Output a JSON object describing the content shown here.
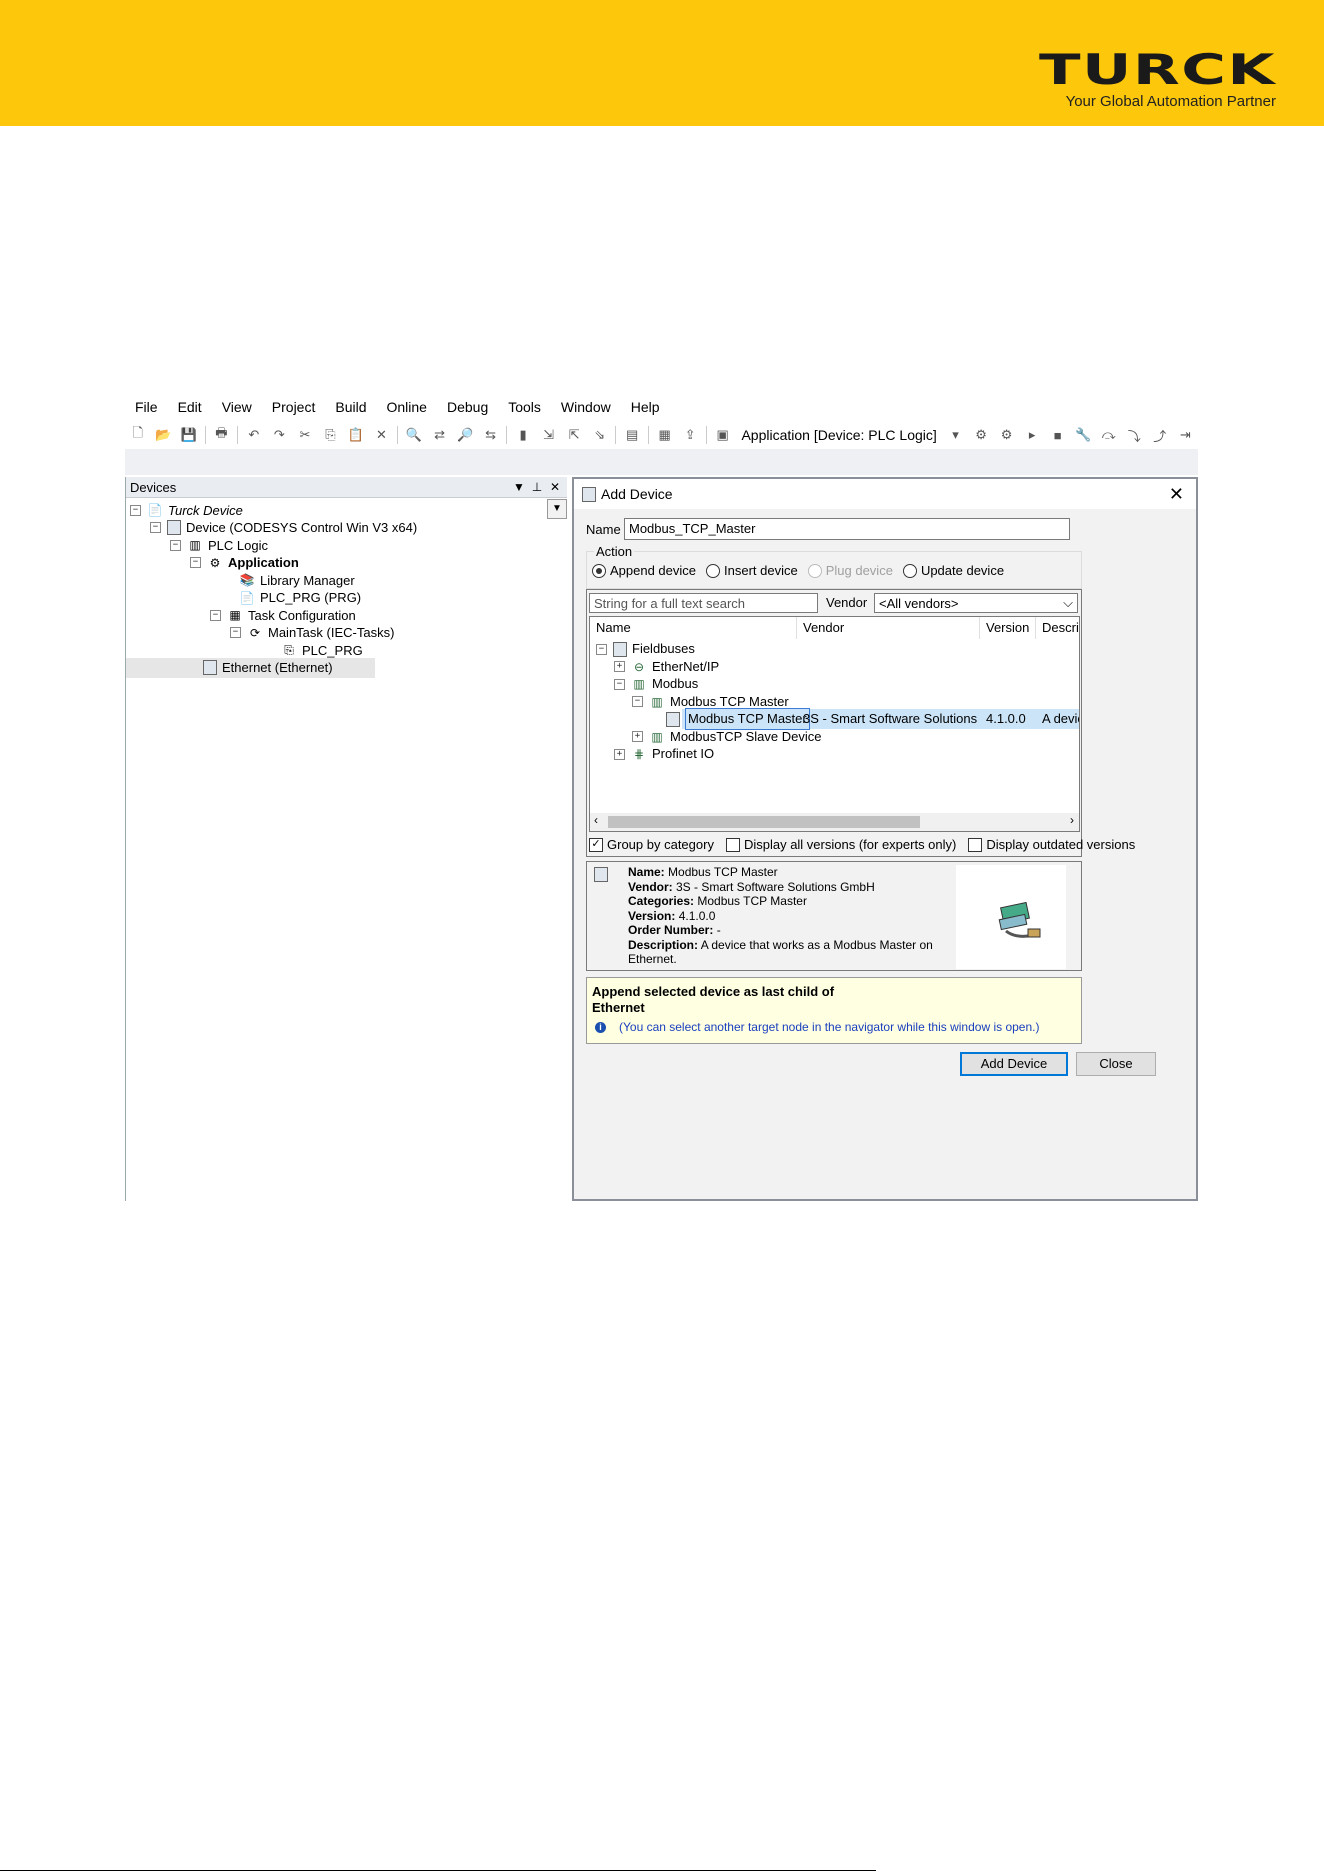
{
  "banner": {
    "color": "#fdc70b",
    "logo_word": "TURCK",
    "logo_tagline": "Your Global Automation Partner"
  },
  "menubar": {
    "items": [
      "File",
      "Edit",
      "View",
      "Project",
      "Build",
      "Online",
      "Debug",
      "Tools",
      "Window",
      "Help"
    ]
  },
  "toolbar": {
    "application_combo": "Application [Device: PLC Logic]"
  },
  "devices_panel": {
    "title": "Devices",
    "tree": [
      {
        "label": "Turck Device",
        "italic": true
      },
      {
        "label": "Device (CODESYS Control Win V3 x64)"
      },
      {
        "label": "PLC Logic"
      },
      {
        "label": "Application",
        "bold": true
      },
      {
        "label": "Library Manager"
      },
      {
        "label": "PLC_PRG (PRG)"
      },
      {
        "label": "Task Configuration"
      },
      {
        "label": "MainTask (IEC-Tasks)"
      },
      {
        "label": "PLC_PRG"
      },
      {
        "label": "Ethernet (Ethernet)",
        "selected": true
      }
    ]
  },
  "dialog": {
    "title": "Add Device",
    "name_label": "Name",
    "name_value": "Modbus_TCP_Master",
    "action_label": "Action",
    "actions": [
      {
        "label": "Append device",
        "selected": true,
        "enabled": true
      },
      {
        "label": "Insert device",
        "selected": false,
        "enabled": true
      },
      {
        "label": "Plug device",
        "selected": false,
        "enabled": false
      },
      {
        "label": "Update device",
        "selected": false,
        "enabled": true
      }
    ],
    "search_placeholder": "String for a full text search",
    "vendor_label": "Vendor",
    "vendor_value": "<All vendors>",
    "columns": [
      "Name",
      "Vendor",
      "Version",
      "Descrip"
    ],
    "rows": [
      {
        "name": "Fieldbuses",
        "vendor": "",
        "version": "",
        "desc": ""
      },
      {
        "name": "EtherNet/IP",
        "vendor": "",
        "version": "",
        "desc": ""
      },
      {
        "name": "Modbus",
        "vendor": "",
        "version": "",
        "desc": ""
      },
      {
        "name": "Modbus TCP Master",
        "vendor": "",
        "version": "",
        "desc": ""
      },
      {
        "name": "Modbus TCP Master",
        "vendor": "3S - Smart Software Solutions GmbH",
        "version": "4.1.0.0",
        "desc": "A device",
        "selected": true
      },
      {
        "name": "ModbusTCP Slave Device",
        "vendor": "",
        "version": "",
        "desc": ""
      },
      {
        "name": "Profinet IO",
        "vendor": "",
        "version": "",
        "desc": ""
      }
    ],
    "options": [
      {
        "label": "Group by category",
        "checked": true
      },
      {
        "label": "Display all versions (for experts only)",
        "checked": false
      },
      {
        "label": "Display outdated versions",
        "checked": false
      }
    ],
    "info": [
      {
        "key": "Name:",
        "value": " Modbus TCP Master"
      },
      {
        "key": "Vendor:",
        "value": " 3S - Smart Software Solutions GmbH"
      },
      {
        "key": "Categories:",
        "value": " Modbus TCP Master"
      },
      {
        "key": "Version:",
        "value": " 4.1.0.0"
      },
      {
        "key": "Order Number:",
        "value": " -"
      },
      {
        "key": "Description:",
        "value": " A device that works as a Modbus Master on Ethernet."
      }
    ],
    "note_line1": "Append selected device as last child of",
    "note_line2": "Ethernet",
    "note_hint": "(You can select another target node in the navigator while this window is open.)",
    "add_button": "Add Device",
    "close_button": "Close"
  }
}
